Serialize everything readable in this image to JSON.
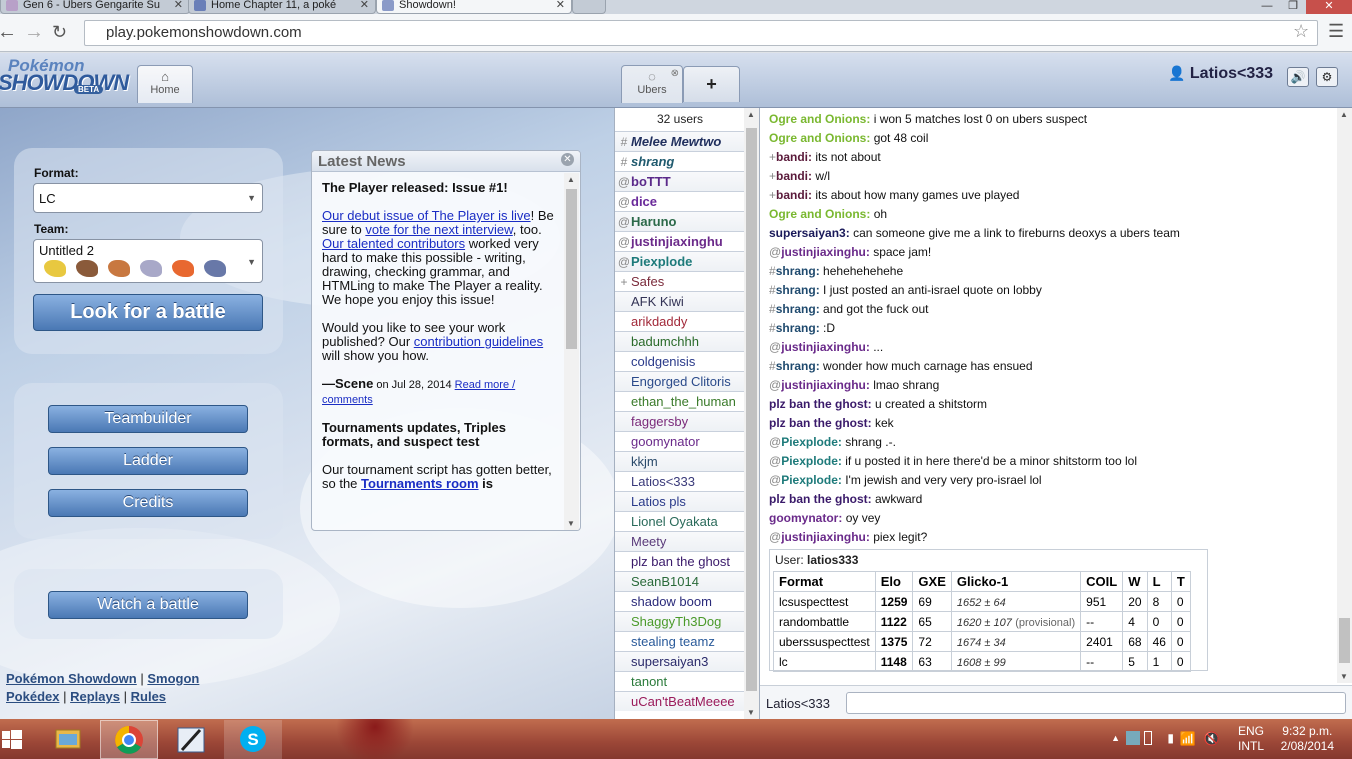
{
  "browser": {
    "tabs": [
      {
        "label": "Gen 6 - Ubers Gengarite Su"
      },
      {
        "label": "Home Chapter 11, a poké"
      },
      {
        "label": "Showdown!"
      }
    ],
    "url": "play.pokemonshowdown.com"
  },
  "header": {
    "logo_top": "Pokémon",
    "logo_main": "SHOWDOWN",
    "logo_beta": "BETA",
    "home_tab": "Home",
    "room_tab": "Ubers",
    "add_tab": "+",
    "username": "Latios<333"
  },
  "home": {
    "format_label": "Format:",
    "format_value": "LC",
    "team_label": "Team:",
    "team_value": "Untitled 2",
    "look_button": "Look for a battle",
    "teambuilder_button": "Teambuilder",
    "ladder_button": "Ladder",
    "credits_button": "Credits",
    "watch_button": "Watch a battle",
    "footer_links": [
      "Pokémon Showdown",
      "Smogon",
      "Pokédex",
      "Replays",
      "Rules"
    ],
    "footer_sep": "|"
  },
  "news": {
    "title": "Latest News",
    "h1": "The Player released: Issue #1!",
    "l1": "Our debut issue of The Player is live",
    "t1": "! Be sure to ",
    "l2": "vote for the next interview",
    "t2": ", too. ",
    "l3": "Our talented contributors",
    "t3": " worked very hard to make this possible - writing, drawing, checking grammar, and HTMLing to make The Player a reality. We hope you enjoy this issue!",
    "p2a": "Would you like to see your work published? Our ",
    "l4": "contribution guidelines",
    "p2b": " will show you how.",
    "sig_name": "—Scene",
    "sig_date": " on Jul 28, 2014 ",
    "sig_link": "Read more / comments",
    "h2": "Tournaments updates, Triples formats, and suspect test",
    "p3a": "Our tournament script has gotten better, so the ",
    "l5": "Tournaments room",
    "p3b": " is"
  },
  "userlist": {
    "count": "32 users",
    "users": [
      {
        "sym": "#",
        "name": "Melee Mewtwo",
        "color": "#21305e",
        "style": "bi"
      },
      {
        "sym": "#",
        "name": "shrang",
        "color": "#1f5a6e",
        "style": "bi"
      },
      {
        "sym": "@",
        "name": "boTTT",
        "color": "#5b2a8a",
        "style": "b"
      },
      {
        "sym": "@",
        "name": "dice",
        "color": "#6a2a9a",
        "style": "b"
      },
      {
        "sym": "@",
        "name": "Haruno",
        "color": "#2c6a4a",
        "style": "b"
      },
      {
        "sym": "@",
        "name": "justinjiaxinghu",
        "color": "#6b2a8a",
        "style": "b"
      },
      {
        "sym": "@",
        "name": "Piexplode",
        "color": "#1d7a7a",
        "style": "b"
      },
      {
        "sym": "+",
        "name": "Safes",
        "color": "#7a2a3a",
        "style": "n"
      },
      {
        "sym": "",
        "name": "AFK Kiwi",
        "color": "#333355",
        "style": "n"
      },
      {
        "sym": "",
        "name": "arikdaddy",
        "color": "#a22a3a",
        "style": "n"
      },
      {
        "sym": "",
        "name": "badumchhh",
        "color": "#2a6a2a",
        "style": "n"
      },
      {
        "sym": "",
        "name": "coldgenisis",
        "color": "#2a3a8a",
        "style": "n"
      },
      {
        "sym": "",
        "name": "Engorged Clitoris",
        "color": "#2a4a8a",
        "style": "n"
      },
      {
        "sym": "",
        "name": "ethan_the_human",
        "color": "#3a7a2a",
        "style": "n"
      },
      {
        "sym": "",
        "name": "faggersby",
        "color": "#7a2a7a",
        "style": "n"
      },
      {
        "sym": "",
        "name": "goomynator",
        "color": "#6a2a8a",
        "style": "n"
      },
      {
        "sym": "",
        "name": "kkjm",
        "color": "#2a4a6a",
        "style": "n"
      },
      {
        "sym": "",
        "name": "Latios<333",
        "color": "#3a3a7a",
        "style": "n"
      },
      {
        "sym": "",
        "name": "Latios pls",
        "color": "#2a3a8a",
        "style": "n"
      },
      {
        "sym": "",
        "name": "Lionel Oyakata",
        "color": "#2a6a5a",
        "style": "n"
      },
      {
        "sym": "",
        "name": "Meety",
        "color": "#5a3a7a",
        "style": "n"
      },
      {
        "sym": "",
        "name": "plz ban the ghost",
        "color": "#3a1a6a",
        "style": "n"
      },
      {
        "sym": "",
        "name": "SeanB1014",
        "color": "#2a6a3a",
        "style": "n"
      },
      {
        "sym": "",
        "name": "shadow boom",
        "color": "#2a2a7a",
        "style": "n"
      },
      {
        "sym": "",
        "name": "ShaggyTh3Dog",
        "color": "#4a9a2a",
        "style": "n"
      },
      {
        "sym": "",
        "name": "stealing teamz",
        "color": "#2a5a9a",
        "style": "n"
      },
      {
        "sym": "",
        "name": "supersaiyan3",
        "color": "#2a2a6a",
        "style": "n"
      },
      {
        "sym": "",
        "name": "tanont",
        "color": "#2a7a3a",
        "style": "n"
      },
      {
        "sym": "",
        "name": "uCan'tBeatMeeee",
        "color": "#9a1a5a",
        "style": "n"
      }
    ]
  },
  "chat": {
    "messages": [
      {
        "rank": "",
        "user": "Ogre and Onions:",
        "color": "#7ab830",
        "text": "i won 5 matches lost 0 on ubers suspect"
      },
      {
        "rank": "",
        "user": "Ogre and Onions:",
        "color": "#7ab830",
        "text": "got 48 coil"
      },
      {
        "rank": "+",
        "user": "bandi:",
        "color": "#5a1a3a",
        "text": "its not about"
      },
      {
        "rank": "+",
        "user": "bandi:",
        "color": "#5a1a3a",
        "text": "w/l"
      },
      {
        "rank": "+",
        "user": "bandi:",
        "color": "#5a1a3a",
        "text": "its about how many games uve played"
      },
      {
        "rank": "",
        "user": "Ogre and Onions:",
        "color": "#7ab830",
        "text": "oh"
      },
      {
        "rank": "",
        "user": "supersaiyan3:",
        "color": "#1a1a5a",
        "text": "can someone give me a link to fireburns deoxys a ubers team"
      },
      {
        "rank": "@",
        "user": "justinjiaxinghu:",
        "color": "#6a2a8a",
        "text": "space jam!"
      },
      {
        "rank": "#",
        "user": "shrang:",
        "color": "#1f4a6e",
        "text": "hehehehehehe"
      },
      {
        "rank": "#",
        "user": "shrang:",
        "color": "#1f4a6e",
        "text": "I just posted an anti-israel quote on lobby"
      },
      {
        "rank": "#",
        "user": "shrang:",
        "color": "#1f4a6e",
        "text": "and got the fuck out"
      },
      {
        "rank": "#",
        "user": "shrang:",
        "color": "#1f4a6e",
        "text": ":D"
      },
      {
        "rank": "@",
        "user": "justinjiaxinghu:",
        "color": "#6a2a8a",
        "text": "..."
      },
      {
        "rank": "#",
        "user": "shrang:",
        "color": "#1f4a6e",
        "text": "wonder how much carnage has ensued"
      },
      {
        "rank": "@",
        "user": "justinjiaxinghu:",
        "color": "#6a2a8a",
        "text": "lmao shrang"
      },
      {
        "rank": "",
        "user": "plz ban the ghost:",
        "color": "#3a1a6a",
        "text": "u created a shitstorm"
      },
      {
        "rank": "",
        "user": "plz ban the ghost:",
        "color": "#3a1a6a",
        "text": "kek"
      },
      {
        "rank": "@",
        "user": "Piexplode:",
        "color": "#1d7a7a",
        "text": "shrang .-."
      },
      {
        "rank": "@",
        "user": "Piexplode:",
        "color": "#1d7a7a",
        "text": "if u posted it in here there'd be a minor shitstorm too lol"
      },
      {
        "rank": "@",
        "user": "Piexplode:",
        "color": "#1d7a7a",
        "text": "I'm jewish and very very pro-israel lol"
      },
      {
        "rank": "",
        "user": "plz ban the ghost:",
        "color": "#3a1a6a",
        "text": "awkward"
      },
      {
        "rank": "",
        "user": "goomynator:",
        "color": "#6a2a8a",
        "text": "oy vey"
      },
      {
        "rank": "@",
        "user": "justinjiaxinghu:",
        "color": "#6a2a8a",
        "text": "piex legit?"
      }
    ],
    "input_name": "Latios<333"
  },
  "rankbox": {
    "user_label": "User:",
    "user_name": "latios333",
    "headers": [
      "Format",
      "Elo",
      "GXE",
      "Glicko-1",
      "COIL",
      "W",
      "L",
      "T"
    ],
    "rows": [
      {
        "format": "lcsuspecttest",
        "elo": "1259",
        "gxe": "69",
        "glicko": "1652 ± 64",
        "prov": "",
        "coil": "951",
        "w": "20",
        "l": "8",
        "t": "0"
      },
      {
        "format": "randombattle",
        "elo": "1122",
        "gxe": "65",
        "glicko": "1620 ± 107",
        "prov": "(provisional)",
        "coil": "--",
        "w": "4",
        "l": "0",
        "t": "0"
      },
      {
        "format": "uberssuspecttest",
        "elo": "1375",
        "gxe": "72",
        "glicko": "1674 ± 34",
        "prov": "",
        "coil": "2401",
        "w": "68",
        "l": "46",
        "t": "0"
      },
      {
        "format": "lc",
        "elo": "1148",
        "gxe": "63",
        "glicko": "1608 ± 99",
        "prov": "",
        "coil": "--",
        "w": "5",
        "l": "1",
        "t": "0"
      }
    ]
  },
  "taskbar": {
    "lang1": "ENG",
    "lang2": "INTL",
    "time": "9:32 p.m.",
    "date": "2/08/2014"
  }
}
